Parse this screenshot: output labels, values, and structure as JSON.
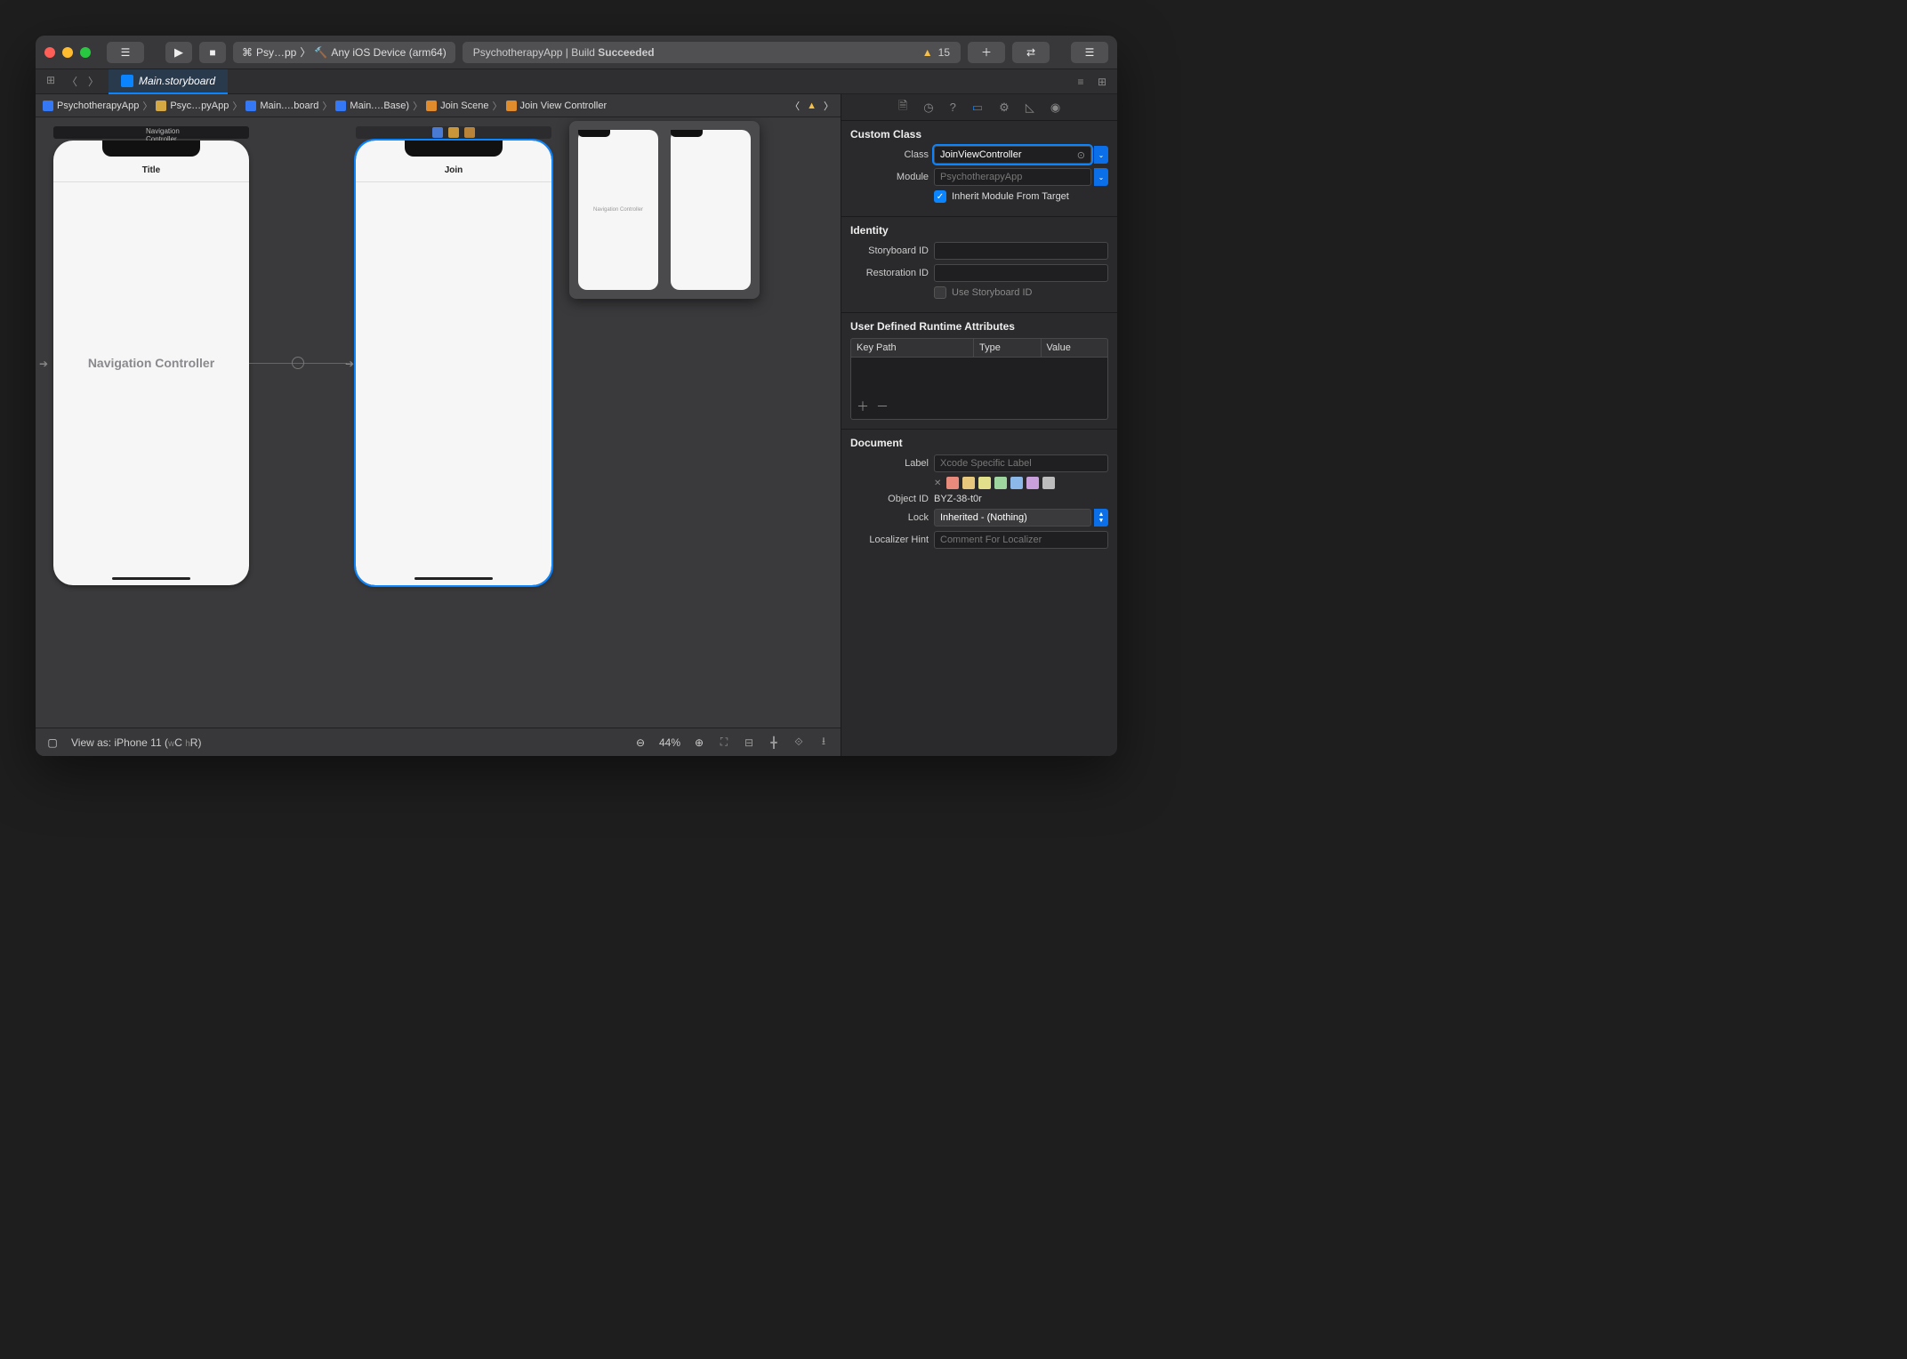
{
  "toolbar": {
    "scheme_app": "Psy…pp",
    "scheme_device": "Any iOS Device (arm64)",
    "status_project": "PsychotherapyApp",
    "status_separator": " | Build ",
    "status_result": "Succeeded",
    "warning_count": "15"
  },
  "tab": {
    "filename": "Main.storyboard"
  },
  "jumpbar": {
    "app": "PsychotherapyApp",
    "folder": "Psyc…pyApp",
    "file": "Main.…board",
    "base": "Main.…Base)",
    "scene": "Join Scene",
    "controller": "Join View Controller"
  },
  "canvas": {
    "scene1_label": "Navigation Controller",
    "scene1_nav_title": "Title",
    "scene1_center": "Navigation Controller",
    "scene2_nav_title": "Join",
    "minimap_text": "Navigation Controller"
  },
  "bottombar": {
    "view_as": "View as: iPhone 11 (",
    "wc": "C",
    "hr": "R",
    "close": ")",
    "zoom": "44%"
  },
  "inspector": {
    "custom_class": {
      "title": "Custom Class",
      "class_label": "Class",
      "class_value": "JoinViewController",
      "module_label": "Module",
      "module_placeholder": "PsychotherapyApp",
      "inherit_label": "Inherit Module From Target"
    },
    "identity": {
      "title": "Identity",
      "storyboard_id_label": "Storyboard ID",
      "restoration_id_label": "Restoration ID",
      "use_sbid_label": "Use Storyboard ID"
    },
    "runtime_attrs": {
      "title": "User Defined Runtime Attributes",
      "col_keypath": "Key Path",
      "col_type": "Type",
      "col_value": "Value"
    },
    "document": {
      "title": "Document",
      "label_label": "Label",
      "label_placeholder": "Xcode Specific Label",
      "object_id_label": "Object ID",
      "object_id_value": "BYZ-38-t0r",
      "lock_label": "Lock",
      "lock_value": "Inherited - (Nothing)",
      "localizer_label": "Localizer Hint",
      "localizer_placeholder": "Comment For Localizer",
      "swatches": [
        "#3a3a3c",
        "#e88b7d",
        "#e8c87d",
        "#e2e08a",
        "#9fd69f",
        "#8bb8e8",
        "#c9a0dc",
        "#bdbdbd"
      ]
    }
  }
}
